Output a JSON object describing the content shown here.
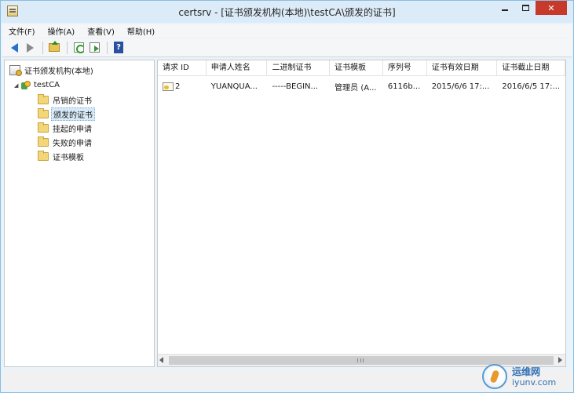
{
  "window": {
    "title": "certsrv - [证书颁发机构(本地)\\testCA\\颁发的证书]",
    "controls": {
      "close_label": "✕"
    }
  },
  "menu": [
    "文件(F)",
    "操作(A)",
    "查看(V)",
    "帮助(H)"
  ],
  "toolbar": {
    "icons": [
      "back-arrow-icon",
      "forward-arrow-icon",
      "up-folder-icon",
      "refresh-icon",
      "export-list-icon",
      "help-icon"
    ],
    "help_glyph": "?"
  },
  "tree": {
    "root": "证书颁发机构(本地)",
    "ca": "testCA",
    "expander_glyph": "◢",
    "folders": [
      "吊销的证书",
      "颁发的证书",
      "挂起的申请",
      "失败的申请",
      "证书模板"
    ],
    "selected_index": 1
  },
  "list": {
    "columns": [
      "请求 ID",
      "申请人姓名",
      "二进制证书",
      "证书模板",
      "序列号",
      "证书有效日期",
      "证书截止日期"
    ],
    "rows": [
      [
        "2",
        "YUANQUA...",
        "-----BEGIN...",
        "管理员 (A...",
        "6116b...",
        "2015/6/6 17:...",
        "2016/6/5 17:..."
      ]
    ]
  },
  "watermark": {
    "cn": "运维网",
    "en": "iyunv.com"
  },
  "colors": {
    "title_bar": "#dcebf8",
    "close_button": "#c7392a",
    "selection": "#d9ebf9"
  }
}
